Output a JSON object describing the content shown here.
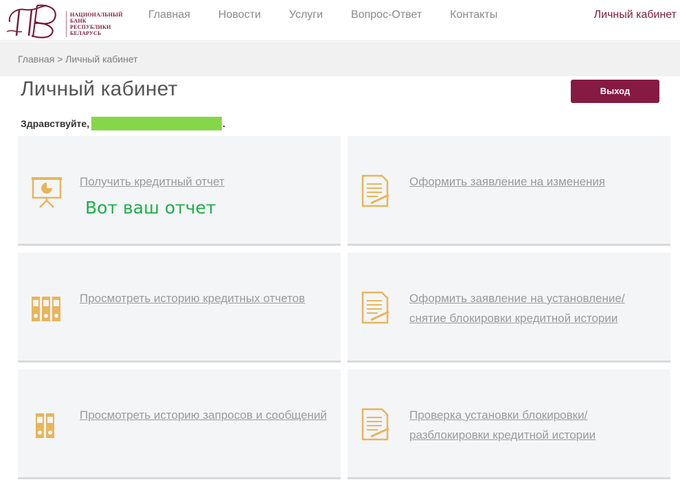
{
  "brand": {
    "logo_lines": [
      "НАЦИОНАЛЬНЫЙ",
      "БАНК",
      "РЕСПУБЛИКИ",
      "БЕЛАРУСЬ"
    ],
    "logo_icon": "monogram-logo",
    "color": "#7a1b3f"
  },
  "nav": {
    "items": [
      {
        "label": "Главная"
      },
      {
        "label": "Новости"
      },
      {
        "label": "Услуги"
      },
      {
        "label": "Вопрос-Ответ"
      },
      {
        "label": "Контакты"
      }
    ],
    "cabinet_label": "Личный кабинет"
  },
  "breadcrumb": {
    "home": "Главная",
    "separator": ">",
    "current": "Личный кабинет"
  },
  "page": {
    "title": "Личный кабинет",
    "logout_label": "Выход",
    "greeting": "Здравствуйте,",
    "greeting_end": "."
  },
  "cards": [
    {
      "link": "Получить кредитный отчет",
      "note": "Вот ваш отчет",
      "icon": "presentation-chart-icon"
    },
    {
      "link": "Оформить заявление на изменения",
      "icon": "document-pen-icon"
    },
    {
      "link": "Просмотреть историю кредитных отчетов",
      "icon": "binders-icon"
    },
    {
      "link": "Оформить заявление на установление/ снятие блокировки кредитной истории",
      "icon": "document-pen-icon"
    },
    {
      "link": "Просмотреть историю запросов и сообщений",
      "icon": "binders-small-icon"
    },
    {
      "link": "Проверка установки блокировки/ разблокировки кредитной истории",
      "icon": "document-pen-icon"
    }
  ],
  "colors": {
    "accent": "#861a43",
    "icon_gold": "#e8b55a",
    "card_bg": "#f4f5f7",
    "note_green": "#1cae49",
    "mask_green": "#86d64a"
  }
}
